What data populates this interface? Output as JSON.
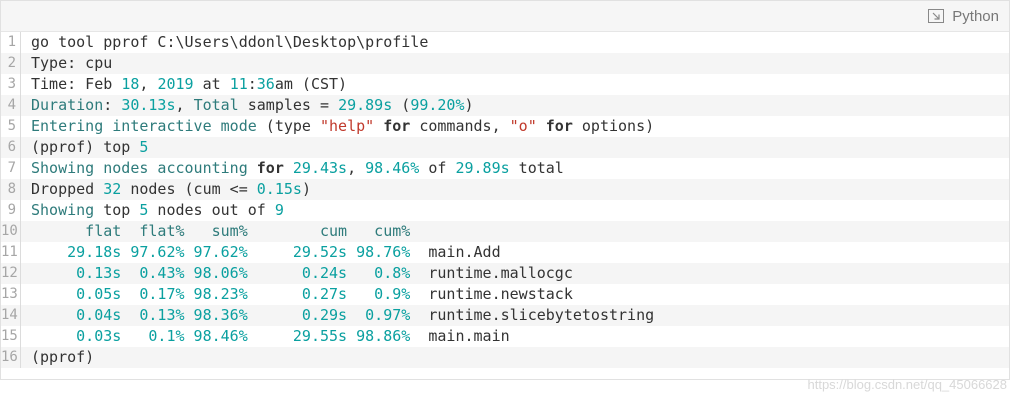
{
  "toolbar": {
    "language": "Python",
    "icon": "expand-icon"
  },
  "code_lines": [
    [
      [
        "plain",
        "go tool pprof C:\\Users\\ddonl\\Desktop\\profile"
      ]
    ],
    [
      [
        "plain",
        "Type: cpu"
      ]
    ],
    [
      [
        "plain",
        "Time: Feb "
      ],
      [
        "num",
        "18"
      ],
      [
        "plain",
        ", "
      ],
      [
        "num",
        "2019"
      ],
      [
        "plain",
        " at "
      ],
      [
        "num",
        "11"
      ],
      [
        "plain",
        ":"
      ],
      [
        "num",
        "36"
      ],
      [
        "plain",
        "am (CST)"
      ]
    ],
    [
      [
        "ident",
        "Duration"
      ],
      [
        "plain",
        ": "
      ],
      [
        "num",
        "30.13s"
      ],
      [
        "plain",
        ", "
      ],
      [
        "ident",
        "Total"
      ],
      [
        "plain",
        " samples = "
      ],
      [
        "num",
        "29.89s"
      ],
      [
        "plain",
        " ("
      ],
      [
        "num",
        "99.20%"
      ],
      [
        "plain",
        ")"
      ]
    ],
    [
      [
        "ident",
        "Entering interactive mode"
      ],
      [
        "plain",
        " (type "
      ],
      [
        "str",
        "\"help\""
      ],
      [
        "plain",
        " "
      ],
      [
        "kw",
        "for"
      ],
      [
        "plain",
        " commands, "
      ],
      [
        "str",
        "\"o\""
      ],
      [
        "plain",
        " "
      ],
      [
        "kw",
        "for"
      ],
      [
        "plain",
        " options)"
      ]
    ],
    [
      [
        "plain",
        "(pprof) top "
      ],
      [
        "num",
        "5"
      ]
    ],
    [
      [
        "ident",
        "Showing nodes accounting "
      ],
      [
        "kw",
        "for"
      ],
      [
        "plain",
        " "
      ],
      [
        "num",
        "29.43s"
      ],
      [
        "plain",
        ", "
      ],
      [
        "num",
        "98.46%"
      ],
      [
        "plain",
        " of "
      ],
      [
        "num",
        "29.89s"
      ],
      [
        "plain",
        " total"
      ]
    ],
    [
      [
        "plain",
        "Dropped "
      ],
      [
        "num",
        "32"
      ],
      [
        "plain",
        " nodes (cum <= "
      ],
      [
        "num",
        "0.15s"
      ],
      [
        "plain",
        ")"
      ]
    ],
    [
      [
        "ident",
        "Showing"
      ],
      [
        "plain",
        " top "
      ],
      [
        "num",
        "5"
      ],
      [
        "plain",
        " nodes out of "
      ],
      [
        "num",
        "9"
      ]
    ],
    [
      [
        "ident",
        "      flat  flat%   sum%        cum   cum%"
      ]
    ],
    [
      [
        "num",
        "    29.18s"
      ],
      [
        "num",
        " 97.62%"
      ],
      [
        "num",
        " 97.62%"
      ],
      [
        "num",
        "     29.52s"
      ],
      [
        "num",
        " 98.76%"
      ],
      [
        "plain",
        "  main.Add"
      ]
    ],
    [
      [
        "num",
        "     0.13s"
      ],
      [
        "num",
        "  0.43%"
      ],
      [
        "num",
        " 98.06%"
      ],
      [
        "num",
        "      0.24s"
      ],
      [
        "num",
        "   0.8%"
      ],
      [
        "plain",
        "  runtime.mallocgc"
      ]
    ],
    [
      [
        "num",
        "     0.05s"
      ],
      [
        "num",
        "  0.17%"
      ],
      [
        "num",
        " 98.23%"
      ],
      [
        "num",
        "      0.27s"
      ],
      [
        "num",
        "   0.9%"
      ],
      [
        "plain",
        "  runtime.newstack"
      ]
    ],
    [
      [
        "num",
        "     0.04s"
      ],
      [
        "num",
        "  0.13%"
      ],
      [
        "num",
        " 98.36%"
      ],
      [
        "num",
        "      0.29s"
      ],
      [
        "num",
        "  0.97%"
      ],
      [
        "plain",
        "  runtime.slicebytetostring"
      ]
    ],
    [
      [
        "num",
        "     0.03s"
      ],
      [
        "num",
        "   0.1%"
      ],
      [
        "num",
        " 98.46%"
      ],
      [
        "num",
        "     29.55s"
      ],
      [
        "num",
        " 98.86%"
      ],
      [
        "plain",
        "  main.main"
      ]
    ],
    [
      [
        "plain",
        "(pprof)"
      ]
    ]
  ],
  "watermark": "https://blog.csdn.net/qq_45066628"
}
